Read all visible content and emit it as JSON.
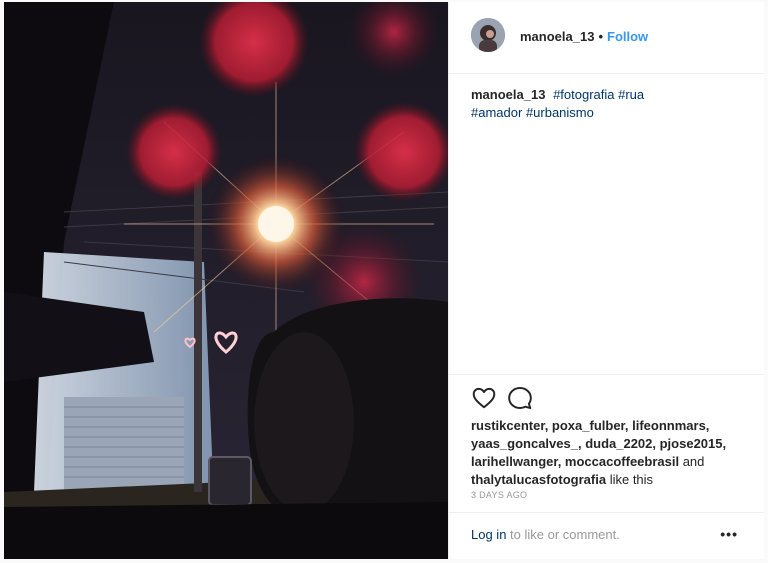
{
  "post": {
    "username": "manoela_13",
    "follow_label": "Follow",
    "separator": "•",
    "caption": {
      "username": "manoela_13",
      "hashtags": [
        "#fotografia",
        "#rua",
        "#amador",
        "#urbanismo"
      ]
    },
    "likes": {
      "likers_line1": "rustikcenter, poxa_fulber, lifeonnmars,",
      "likers_line2": "yaas_goncalves_, duda_2202, pjose2015,",
      "likers_line3_a": "larihellwanger, moccacoffeebrasil",
      "and_word": " and ",
      "likers_line4": "thalytalucasfotografia",
      "suffix": " like this"
    },
    "timestamp": "3 DAYS AGO",
    "login_link": "Log in",
    "login_rest": " to like or comment.",
    "more_label": "•••"
  },
  "icons": {
    "like": "heart-outline-icon",
    "comment": "speech-bubble-icon",
    "more": "ellipsis-icon"
  },
  "colors": {
    "link_blue": "#3897f0",
    "hashtag_navy": "#003569",
    "muted": "#999999",
    "text": "#262626"
  }
}
